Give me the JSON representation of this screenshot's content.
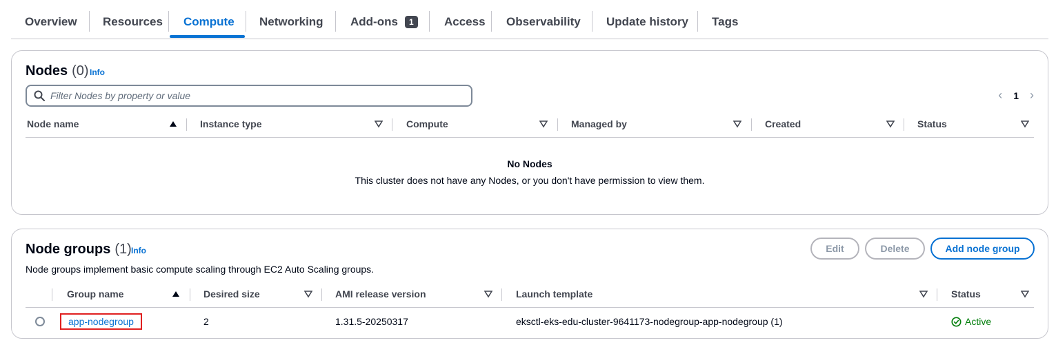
{
  "tabs": [
    {
      "label": "Overview"
    },
    {
      "label": "Resources"
    },
    {
      "label": "Compute"
    },
    {
      "label": "Networking"
    },
    {
      "label": "Add-ons",
      "badge": "1"
    },
    {
      "label": "Access"
    },
    {
      "label": "Observability"
    },
    {
      "label": "Update history"
    },
    {
      "label": "Tags"
    }
  ],
  "active_tab": "Compute",
  "nodes": {
    "title": "Nodes",
    "count": "(0)",
    "info": "Info",
    "filter_placeholder": "Filter Nodes by property or value",
    "page": "1",
    "columns": [
      "Node name",
      "Instance type",
      "Compute",
      "Managed by",
      "Created",
      "Status"
    ],
    "empty_title": "No Nodes",
    "empty_desc": "This cluster does not have any Nodes, or you don't have permission to view them."
  },
  "node_groups": {
    "title": "Node groups",
    "count": "(1)",
    "info": "Info",
    "edit_label": "Edit",
    "delete_label": "Delete",
    "add_label": "Add node group",
    "description": "Node groups implement basic compute scaling through EC2 Auto Scaling groups.",
    "columns": [
      "Group name",
      "Desired size",
      "AMI release version",
      "Launch template",
      "Status"
    ],
    "rows": [
      {
        "group_name": "app-nodegroup",
        "desired_size": "2",
        "ami_release_version": "1.31.5-20250317",
        "launch_template": "eksctl-eks-edu-cluster-9641173-nodegroup-app-nodegroup (1)",
        "status": "Active"
      }
    ]
  },
  "colors": {
    "accent": "#0972d3",
    "success": "#037f0c",
    "highlight": "#e02020"
  }
}
